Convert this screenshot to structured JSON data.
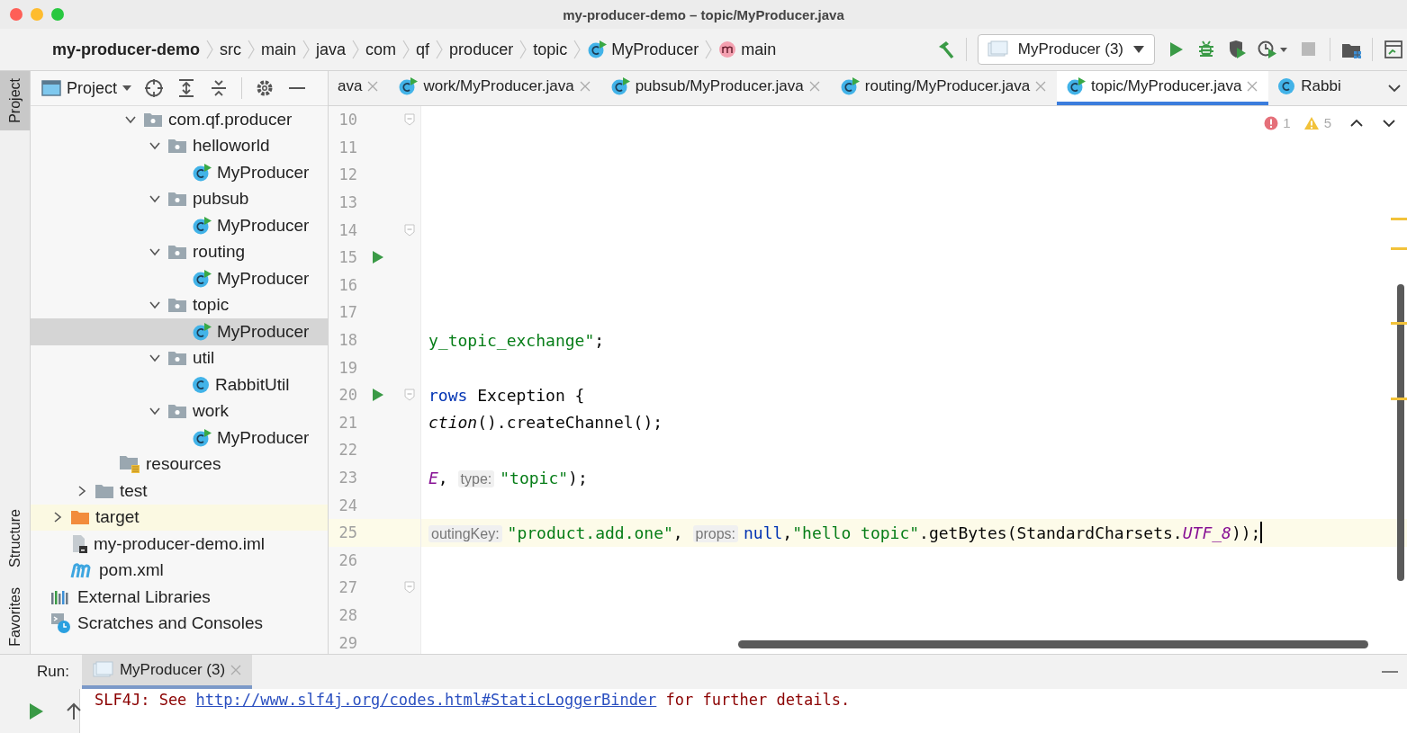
{
  "window": {
    "title": "my-producer-demo – topic/MyProducer.java"
  },
  "breadcrumbs": [
    {
      "label": "my-producer-demo"
    },
    {
      "label": "src"
    },
    {
      "label": "main"
    },
    {
      "label": "java"
    },
    {
      "label": "com"
    },
    {
      "label": "qf"
    },
    {
      "label": "producer"
    },
    {
      "label": "topic"
    },
    {
      "label": "MyProducer",
      "kind": "class-run"
    },
    {
      "label": "main",
      "kind": "method"
    }
  ],
  "run_config": {
    "label": "MyProducer (3)"
  },
  "toolbar": [
    {
      "kind": "build",
      "disabled": false
    },
    {
      "kind": "config"
    },
    {
      "kind": "run",
      "disabled": false
    },
    {
      "kind": "debug",
      "disabled": false
    },
    {
      "kind": "coverage",
      "disabled": false
    },
    {
      "kind": "profile",
      "disabled": false
    },
    {
      "kind": "stop",
      "disabled": true
    },
    {
      "kind": "structure",
      "disabled": false
    },
    {
      "kind": "panel",
      "disabled": false
    }
  ],
  "side_tabs": [
    {
      "label": "Project",
      "selected": true
    },
    {
      "label": "Structure",
      "selected": false
    },
    {
      "label": "Favorites",
      "selected": false
    }
  ],
  "project_panel": {
    "title": "Project"
  },
  "tree": [
    {
      "children": [
        {
          "children": [
            {
              "children": [
                {
                  "children": [
                    {
                      "label": "com.qf.producer",
                      "kind": "package",
                      "expanded": true,
                      "selected": false,
                      "highlighted": false,
                      "children": [
                        {
                          "label": "helloworld",
                          "kind": "package",
                          "expanded": true,
                          "selected": false,
                          "highlighted": false,
                          "children": [
                            {
                              "label": "MyProducer",
                              "kind": "class-run",
                              "selected": false,
                              "highlighted": false
                            }
                          ]
                        },
                        {
                          "label": "pubsub",
                          "kind": "package",
                          "expanded": true,
                          "selected": false,
                          "highlighted": false,
                          "children": [
                            {
                              "label": "MyProducer",
                              "kind": "class-run",
                              "selected": false,
                              "highlighted": false
                            }
                          ]
                        },
                        {
                          "label": "routing",
                          "kind": "package",
                          "expanded": true,
                          "selected": false,
                          "highlighted": false,
                          "children": [
                            {
                              "label": "MyProducer",
                              "kind": "class-run",
                              "selected": false,
                              "highlighted": false
                            }
                          ]
                        },
                        {
                          "label": "topic",
                          "kind": "package",
                          "expanded": true,
                          "selected": false,
                          "highlighted": false,
                          "children": [
                            {
                              "label": "MyProducer",
                              "kind": "class-run",
                              "selected": true,
                              "highlighted": false
                            }
                          ]
                        },
                        {
                          "label": "util",
                          "kind": "package",
                          "expanded": true,
                          "selected": false,
                          "highlighted": false,
                          "children": [
                            {
                              "label": "RabbitUtil",
                              "kind": "class",
                              "selected": false,
                              "highlighted": false
                            }
                          ]
                        },
                        {
                          "label": "work",
                          "kind": "package",
                          "expanded": true,
                          "selected": false,
                          "highlighted": false,
                          "children": [
                            {
                              "label": "MyProducer",
                              "kind": "class-run",
                              "selected": false,
                              "highlighted": false
                            }
                          ]
                        }
                      ]
                    }
                  ]
                },
                {
                  "label": "resources",
                  "kind": "resources",
                  "selected": false,
                  "highlighted": false
                }
              ]
            },
            {
              "label": "test",
              "kind": "folder",
              "expanded": false,
              "selected": false,
              "highlighted": false
            }
          ]
        },
        {
          "label": "target",
          "kind": "excluded",
          "expanded": false,
          "selected": false,
          "highlighted": true
        },
        {
          "label": "my-producer-demo.iml",
          "kind": "iml",
          "selected": false,
          "highlighted": false
        },
        {
          "label": "pom.xml",
          "kind": "maven",
          "selected": false,
          "highlighted": false
        }
      ]
    },
    {
      "label": "External Libraries",
      "kind": "libraries",
      "selected": false,
      "highlighted": false
    },
    {
      "label": "Scratches and Consoles",
      "kind": "scratches",
      "selected": false,
      "highlighted": false
    }
  ],
  "editor_tabs": [
    {
      "label": "ava",
      "selected": false,
      "closable": true
    },
    {
      "label": "work/MyProducer.java",
      "kind": "class-run",
      "selected": false,
      "closable": true
    },
    {
      "label": "pubsub/MyProducer.java",
      "kind": "class-run",
      "selected": false,
      "closable": true
    },
    {
      "label": "routing/MyProducer.java",
      "kind": "class-run",
      "selected": false,
      "closable": true
    },
    {
      "label": "topic/MyProducer.java",
      "kind": "class-run",
      "selected": true,
      "closable": true
    },
    {
      "label": "Rabbi",
      "kind": "class",
      "selected": false,
      "closable": false
    }
  ],
  "inspections": {
    "errors": "1",
    "warnings": "5"
  },
  "code_lines": [
    {
      "number": "10",
      "run_marker": false,
      "fold_marker": true,
      "current": false
    },
    {
      "number": "11",
      "run_marker": false,
      "fold_marker": false,
      "current": false
    },
    {
      "number": "12",
      "run_marker": false,
      "fold_marker": false,
      "current": false
    },
    {
      "number": "13",
      "run_marker": false,
      "fold_marker": false,
      "current": false
    },
    {
      "number": "14",
      "run_marker": false,
      "fold_marker": true,
      "current": false
    },
    {
      "number": "15",
      "run_marker": true,
      "fold_marker": false,
      "current": false
    },
    {
      "number": "16",
      "run_marker": false,
      "fold_marker": false,
      "current": false
    },
    {
      "number": "17",
      "run_marker": false,
      "fold_marker": false,
      "current": false
    },
    {
      "number": "18",
      "run_marker": false,
      "fold_marker": false,
      "current": false,
      "segments": [
        {
          "kind": "string",
          "text": "y_topic_exchange\""
        },
        {
          "kind": "plain",
          "text": ";"
        }
      ]
    },
    {
      "number": "19",
      "run_marker": false,
      "fold_marker": false,
      "current": false
    },
    {
      "number": "20",
      "run_marker": true,
      "fold_marker": true,
      "current": false,
      "segments": [
        {
          "kind": "keyword",
          "text": "rows"
        },
        {
          "kind": "plain",
          "text": " Exception {"
        }
      ]
    },
    {
      "number": "21",
      "run_marker": false,
      "fold_marker": false,
      "current": false,
      "segments": [
        {
          "kind": "italic",
          "text": "ction"
        },
        {
          "kind": "plain",
          "text": "().createChannel();"
        }
      ]
    },
    {
      "number": "22",
      "run_marker": false,
      "fold_marker": false,
      "current": false
    },
    {
      "number": "23",
      "run_marker": false,
      "fold_marker": false,
      "current": false,
      "segments": [
        {
          "kind": "constant",
          "text": "E"
        },
        {
          "kind": "plain",
          "text": ", "
        },
        {
          "kind": "hint",
          "text": "type:"
        },
        {
          "kind": "string",
          "text": "\"topic\""
        },
        {
          "kind": "plain",
          "text": ");"
        }
      ]
    },
    {
      "number": "24",
      "run_marker": false,
      "fold_marker": false,
      "current": false
    },
    {
      "number": "25",
      "run_marker": false,
      "fold_marker": false,
      "current": true,
      "segments": [
        {
          "kind": "hint",
          "text": "outingKey:"
        },
        {
          "kind": "string",
          "text": "\"product.add.one\""
        },
        {
          "kind": "plain",
          "text": ", "
        },
        {
          "kind": "hint",
          "text": "props:"
        },
        {
          "kind": "keyword",
          "text": "null"
        },
        {
          "kind": "plain",
          "text": ","
        },
        {
          "kind": "string",
          "text": "\"hello topic\""
        },
        {
          "kind": "plain",
          "text": ".getBytes(StandardCharsets."
        },
        {
          "kind": "constant",
          "text": "UTF_8"
        },
        {
          "kind": "plain",
          "text": "));"
        }
      ]
    },
    {
      "number": "26",
      "run_marker": false,
      "fold_marker": false,
      "current": false
    },
    {
      "number": "27",
      "run_marker": false,
      "fold_marker": true,
      "current": false
    },
    {
      "number": "28",
      "run_marker": false,
      "fold_marker": false,
      "current": false
    },
    {
      "number": "29",
      "run_marker": false,
      "fold_marker": false,
      "current": false
    }
  ],
  "run_panel": {
    "label": "Run:",
    "tabs": [
      {
        "label": "MyProducer (3)",
        "selected": true
      }
    ],
    "console": [
      {
        "kind": "error",
        "text": "SLF4J: See "
      },
      {
        "kind": "link",
        "text": "http://www.slf4j.org/codes.html#StaticLoggerBinder"
      },
      {
        "kind": "error",
        "text": " for further details."
      }
    ]
  }
}
